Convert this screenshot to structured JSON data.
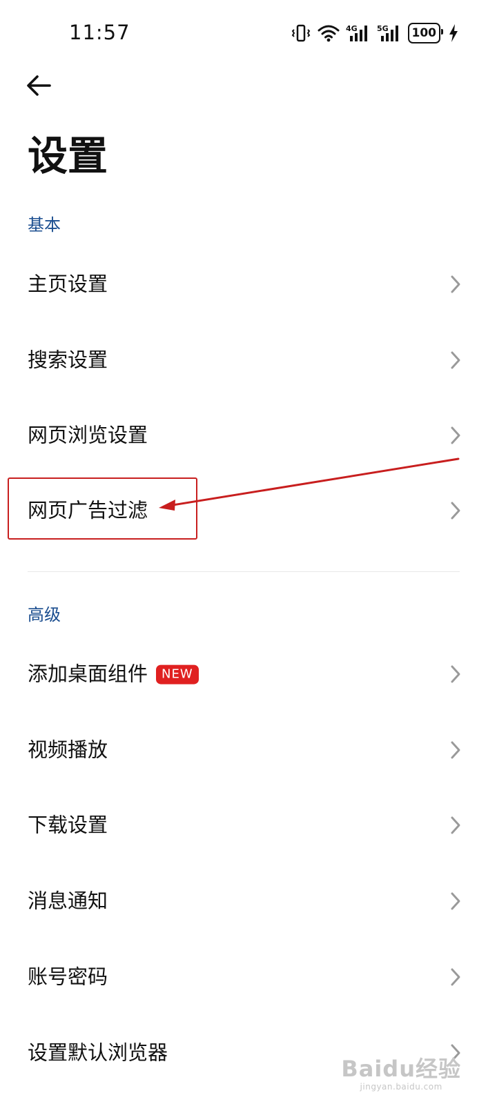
{
  "status_bar": {
    "time": "11:57",
    "network_1": "4G",
    "network_2": "5G",
    "battery": "100",
    "icons": [
      "vibrate-icon",
      "wifi-icon",
      "signal-4g-icon",
      "signal-5g-icon",
      "battery-icon",
      "charging-bolt-icon"
    ]
  },
  "header": {
    "back_icon": "back-arrow-icon",
    "title": "设置"
  },
  "sections": {
    "basic": {
      "title": "基本",
      "items": [
        {
          "label": "主页设置"
        },
        {
          "label": "搜索设置"
        },
        {
          "label": "网页浏览设置"
        },
        {
          "label": "网页广告过滤"
        }
      ]
    },
    "advanced": {
      "title": "高级",
      "items": [
        {
          "label": "添加桌面组件",
          "badge": "NEW"
        },
        {
          "label": "视频播放"
        },
        {
          "label": "下载设置"
        },
        {
          "label": "消息通知"
        },
        {
          "label": "账号密码"
        },
        {
          "label": "设置默认浏览器"
        }
      ]
    }
  },
  "chevron_icon": "chevron-right-icon",
  "annotation": {
    "color": "#c81e1e",
    "highlighted_item": "网页广告过滤"
  },
  "watermark": {
    "logo": "Baidu经验",
    "url": "jingyan.baidu.com"
  },
  "colors": {
    "section_header": "#1a4d8f",
    "badge": "#e02020",
    "text": "#111111",
    "chevron": "#9a9a9a"
  }
}
